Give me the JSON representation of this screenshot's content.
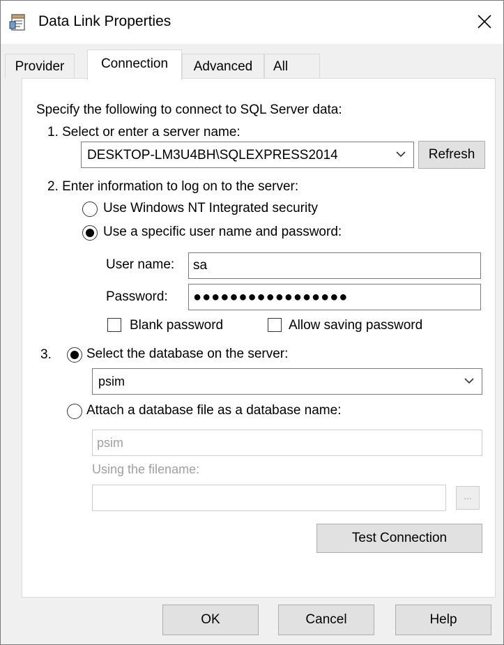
{
  "window": {
    "title": "Data Link Properties"
  },
  "tabs": [
    "Provider",
    "Connection",
    "Advanced",
    "All"
  ],
  "connection": {
    "intro": "Specify the following to connect to SQL Server data:",
    "step1_label": "1. Select or enter a server name:",
    "server_name": "DESKTOP-LM3U4BH\\SQLEXPRESS2014",
    "refresh_label": "Refresh",
    "step2_label": "2. Enter information to log on to the server:",
    "windows_security_label": "Use Windows NT Integrated security",
    "specific_user_label": "Use a specific user name and password:",
    "username_label": "User name:",
    "username_value": "sa",
    "password_label": "Password:",
    "password_value": "●●●●●●●●●●●●●●●●●",
    "blank_password_label": "Blank password",
    "allow_saving_label": "Allow saving password",
    "step3_number": "3.",
    "select_db_label": "Select the database on the server:",
    "database_value": "psim",
    "attach_db_label": "Attach a database file as a database name:",
    "attach_db_value": "psim",
    "filename_label": "Using the filename:",
    "filename_value": "",
    "browse_label": "...",
    "test_connection_label": "Test Connection",
    "selected_logon_option": "specific-user",
    "selected_db_option": "select-database",
    "blank_password_checked": false,
    "allow_saving_checked": false
  },
  "footer": {
    "ok_label": "OK",
    "cancel_label": "Cancel",
    "help_label": "Help"
  },
  "icons": {
    "close": "close-icon",
    "chevron": "chevron-down-icon",
    "app": "data-link-icon"
  }
}
